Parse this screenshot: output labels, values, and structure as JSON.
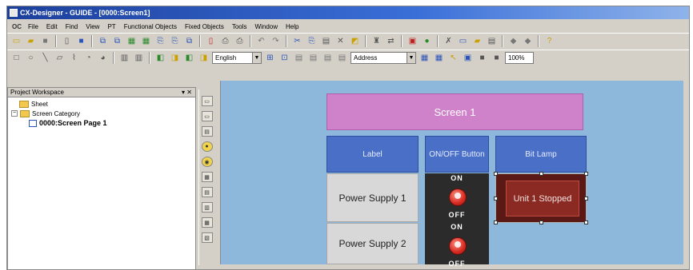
{
  "window": {
    "title": "CX-Designer - GUIDE - [0000:Screen1]"
  },
  "menu": {
    "logo": "OC",
    "items": [
      "File",
      "Edit",
      "Find",
      "View",
      "PT",
      "Functional Objects",
      "Fixed Objects",
      "Tools",
      "Window",
      "Help"
    ]
  },
  "toolbar2": {
    "language": "English",
    "address_mode": "Address",
    "zoom": "100%"
  },
  "workspace": {
    "title": "Project Workspace",
    "header_controls": "▾ ✕",
    "tree": {
      "root": "Sheet",
      "category": "Screen Category",
      "page": "0000:Screen Page 1"
    }
  },
  "canvas": {
    "screen_title": "Screen 1",
    "headers": {
      "label": "Label",
      "onoff": "ON/OFF Button",
      "bitlamp": "Bit Lamp"
    },
    "rows": [
      {
        "label": "Power Supply 1",
        "switch_on": "ON",
        "switch_off": "OFF",
        "lamp": "Unit 1 Stopped"
      },
      {
        "label": "Power Supply 2",
        "switch_on": "ON",
        "switch_off": "OFF"
      }
    ]
  },
  "colors": {
    "title_bar": "#1c3f9c",
    "canvas_bg": "#8eb7dc",
    "screen_title_bg": "#cf82c9",
    "header_bg": "#4a6fc7",
    "label_bg": "#d8d8d8",
    "switch_bg": "#2b2b2b",
    "switch_knob": "#d62a20",
    "bitlamp_bg": "#8a2a22"
  }
}
